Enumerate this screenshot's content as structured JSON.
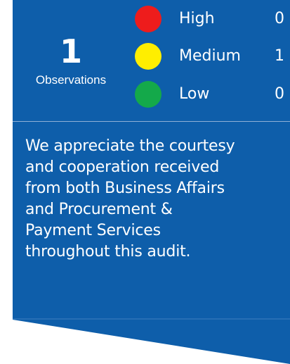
{
  "colors": {
    "panel_blue": "#0e5eaa",
    "divider": "#8fb0d6",
    "text": "#ffffff",
    "high": "#ee1c1c",
    "medium": "#ffee00",
    "low": "#14a94a"
  },
  "summary": {
    "count": "1",
    "count_label": "Observations",
    "ratings": [
      {
        "label": "High",
        "value": "0",
        "color_name": "red-circle"
      },
      {
        "label": "Medium",
        "value": "1",
        "color_name": "yellow-circle"
      },
      {
        "label": "Low",
        "value": "0",
        "color_name": "green-circle"
      }
    ]
  },
  "message": {
    "lines": [
      "We appreciate the courtesy",
      "and cooperation received",
      "from both Business Affairs",
      "and Procurement &",
      "Payment Services",
      "throughout this audit."
    ]
  }
}
